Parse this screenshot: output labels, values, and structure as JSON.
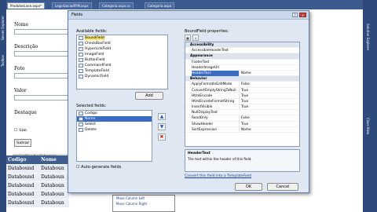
{
  "tabs": [
    "ProdutosLivre.aspx*",
    "LegalizacaoRYM.aspx",
    "Categoria.aspx.cs",
    "Categoria.aspx"
  ],
  "left_strip": [
    "Server Explorer",
    "Toolbox"
  ],
  "right_strip": [
    "Solution Explorer",
    "Class View"
  ],
  "form": {
    "labels": [
      "Nome",
      "Descrição",
      "Foto",
      "Valor",
      "Destaque"
    ],
    "checkbox_label": "Sim",
    "save_button": "Salvar",
    "datasource": "asp:GridView#gvCategorias"
  },
  "grid": {
    "headers": [
      "Codigo",
      "Nome"
    ],
    "rows": [
      [
        "Databound",
        "Databoun"
      ],
      [
        "Databound",
        "Databoun"
      ],
      [
        "Databound",
        "Databoun"
      ],
      [
        "Databound",
        "Databoun"
      ],
      [
        "Databound",
        "Databoun"
      ]
    ]
  },
  "smart_tasks": [
    "Move Column Left",
    "Move Column Right"
  ],
  "dialog": {
    "title": "Fields",
    "available_label": "Available fields:",
    "available": [
      "BoundField",
      "CheckBoxField",
      "HyperLinkField",
      "ImageField",
      "ButtonField",
      "CommandField",
      "TemplateField",
      "DynamicField"
    ],
    "add_button": "Add",
    "selected_label": "Selected fields:",
    "selected": [
      "Codigo",
      "Nome",
      "Select",
      "Delete"
    ],
    "auto_generate": "Auto-generate fields",
    "props_label": "BoundField properties:",
    "properties": [
      {
        "name": "Accessibility",
        "value": "",
        "cat": true
      },
      {
        "name": "AccessibleHeaderText",
        "value": ""
      },
      {
        "name": "Appearance",
        "value": "",
        "cat": true
      },
      {
        "name": "FooterText",
        "value": ""
      },
      {
        "name": "HeaderImageUrl",
        "value": ""
      },
      {
        "name": "HeaderText",
        "value": "Nome",
        "sel": true
      },
      {
        "name": "Behavior",
        "value": "",
        "cat": true
      },
      {
        "name": "ApplyFormatInEditMode",
        "value": "False"
      },
      {
        "name": "ConvertEmptyStringToNull",
        "value": "True"
      },
      {
        "name": "HtmlEncode",
        "value": "True"
      },
      {
        "name": "HtmlEncodeFormatString",
        "value": "True"
      },
      {
        "name": "InsertVisible",
        "value": "True"
      },
      {
        "name": "NullDisplayText",
        "value": ""
      },
      {
        "name": "ReadOnly",
        "value": "False"
      },
      {
        "name": "ShowHeader",
        "value": "True"
      },
      {
        "name": "SortExpression",
        "value": "Nome"
      }
    ],
    "desc_title": "HeaderText",
    "desc_text": "The text within the header of this field.",
    "convert_link": "Convert this field into a TemplateField",
    "ok": "OK",
    "cancel": "Cancel",
    "help_glyph": "?",
    "close_glyph": "x",
    "up_glyph": "▲",
    "down_glyph": "▼",
    "delete_glyph": "✖"
  }
}
